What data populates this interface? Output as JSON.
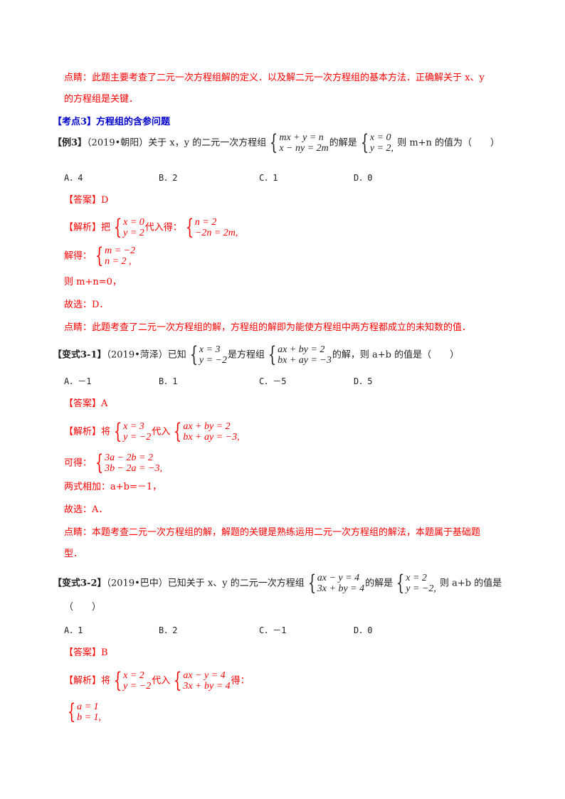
{
  "intro_comment": {
    "line1": "点睛：此题主要考查了二元一次方程组解的定义．以及解二元一次方程组的基本方法．正确解关于 x、y",
    "line2": "的方程组是关键．"
  },
  "section_heading": "【考点3】方程组的含参问题",
  "example3": {
    "tag": "【例3】",
    "source": "（2019•朝阳）关于 x，y 的二元一次方程组",
    "system": [
      "mx + y = n",
      "x − ny = 2m"
    ],
    "mid": "的解是",
    "solution": [
      "x = 0",
      "y = 2,"
    ],
    "tail": " 则 m+n 的值为（　　）",
    "options": [
      "A．4",
      "B．2",
      "C．1",
      "D．0"
    ],
    "answer": "【答案】D",
    "analysis_label": "【解析】把",
    "analysis_sys1": [
      "x = 0",
      "y = 2"
    ],
    "analysis_mid": "代入得：",
    "analysis_sys2": [
      "n = 2",
      "−2n = 2m,"
    ],
    "solve_label": "解得：",
    "solve_sys": [
      "m = −2",
      "n = 2 ,"
    ],
    "then": "则 m+n=0，",
    "choose": "故选：D．",
    "comment": "点睛：此题考查了二元一次方程组的解，方程组的解即为能使方程组中两方程都成立的未知数的值．"
  },
  "variant31": {
    "tag": "【变式3-1】",
    "source": "（2019•菏泽）已知",
    "sys1": [
      "x = 3",
      "y = −2"
    ],
    "mid": "是方程组",
    "sys2": [
      "ax + by = 2",
      "bx + ay = −3"
    ],
    "tail": "的解，则 a+b 的值是（　　）",
    "options": [
      "A．－1",
      "B．1",
      "C．－5",
      "D．5"
    ],
    "answer": "【答案】A",
    "analysis_label": "【解析】将",
    "analysis_sys1": [
      "x = 3",
      "y = −2"
    ],
    "analysis_mid": "代入",
    "analysis_sys2": [
      "ax + by = 2",
      "bx + ay = −3,"
    ],
    "get_label": "可得：",
    "get_sys": [
      "3a − 2b = 2",
      "3b − 2a = −3,"
    ],
    "sum": "两式相加：a+b=－1，",
    "choose": "故选：A．",
    "comment_line1": "点睛：本题考查二元一次方程组的解，解题的关键是熟练运用二元一次方程组的解法，本题属于基础题",
    "comment_line2": "型．"
  },
  "variant32": {
    "tag": "【变式3-2】",
    "source": "（2019•巴中）已知关于 x、y 的二元一次方程组",
    "sys1": [
      "ax − y = 4",
      "3x + by = 4"
    ],
    "mid": "的解是",
    "sys2": [
      "x = 2",
      "y = −2,"
    ],
    "tail": " 则 a+b 的值是",
    "paren": "（　　）",
    "options": [
      "A．1",
      "B．2",
      "C．－1",
      "D．0"
    ],
    "answer": "【答案】B",
    "analysis_label": "【解析】将",
    "analysis_sys1": [
      "x = 2",
      "y = −2"
    ],
    "analysis_mid": "代入",
    "analysis_sys2": [
      "ax − y = 4",
      "3x + by = 4"
    ],
    "analysis_tail": "得：",
    "result_sys": [
      "a = 1",
      "b = 1,"
    ]
  }
}
